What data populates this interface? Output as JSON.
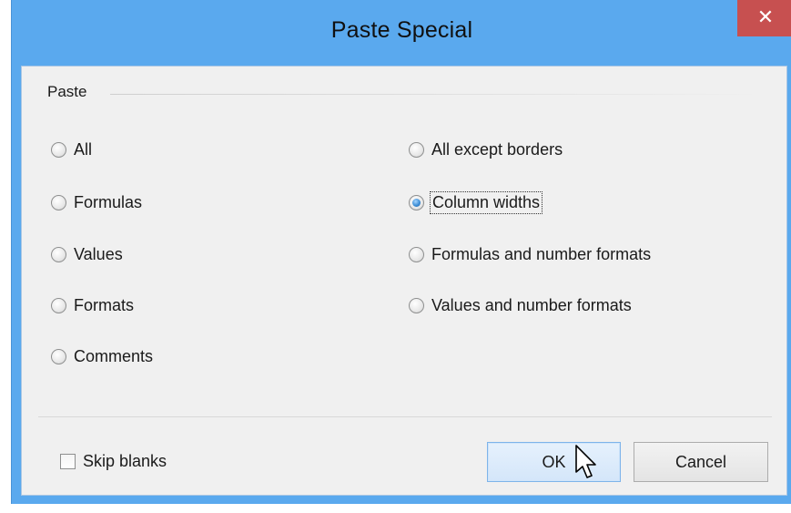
{
  "dialog": {
    "title": "Paste Special",
    "close_glyph": "✕"
  },
  "paste_group": {
    "label": "Paste",
    "left_options": [
      {
        "label": "All",
        "checked": false
      },
      {
        "label": "Formulas",
        "checked": false
      },
      {
        "label": "Values",
        "checked": false
      },
      {
        "label": "Formats",
        "checked": false
      },
      {
        "label": "Comments",
        "checked": false
      }
    ],
    "right_options": [
      {
        "label": "All except borders",
        "checked": false
      },
      {
        "label": "Column widths",
        "checked": true
      },
      {
        "label": "Formulas and number formats",
        "checked": false
      },
      {
        "label": "Values and number formats",
        "checked": false
      }
    ]
  },
  "skip_blanks": {
    "label": "Skip blanks",
    "checked": false
  },
  "buttons": {
    "ok": "OK",
    "cancel": "Cancel"
  },
  "colors": {
    "titlebar": "#5aa9ee",
    "close_button": "#c75050",
    "body": "#f0f0f0",
    "radio_checked": "#3f8fd6"
  },
  "icons": {
    "close": "close-icon",
    "cursor": "mouse-pointer-icon"
  }
}
